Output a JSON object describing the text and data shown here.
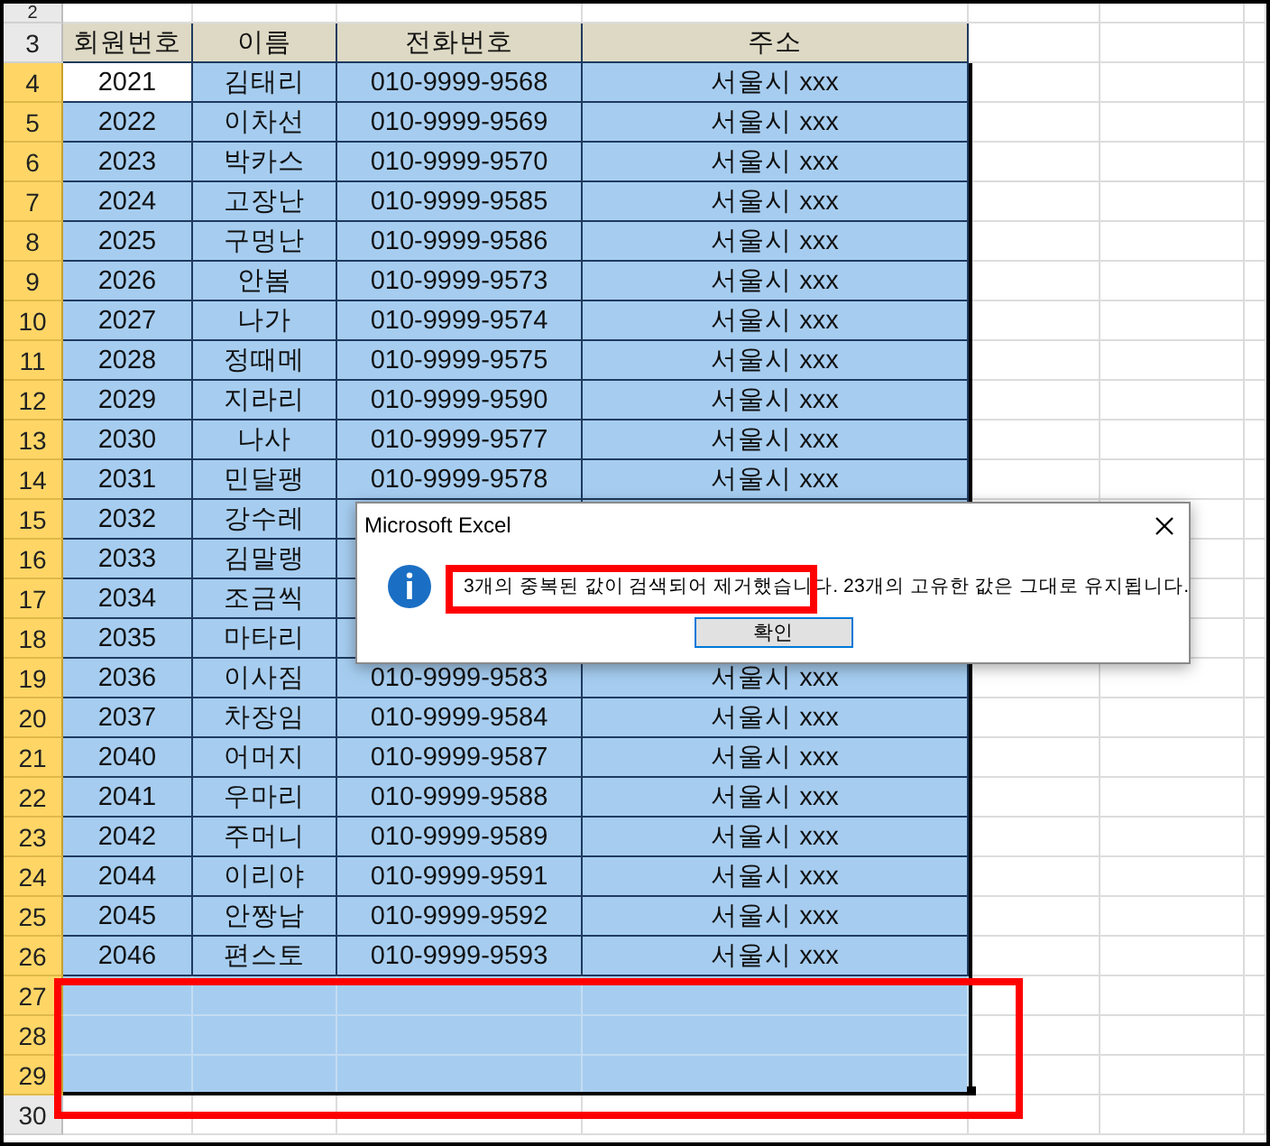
{
  "sheet": {
    "header": {
      "number": "3",
      "cells": [
        "회원번호",
        "이름",
        "전화번호",
        "주소"
      ]
    },
    "rows": [
      {
        "number": "2",
        "selected": false,
        "active": false
      },
      {
        "number": "4",
        "cells": [
          "2021",
          "김태리",
          "010-9999-9568",
          "서울시 xxx"
        ],
        "selected": true,
        "active": true
      },
      {
        "number": "5",
        "cells": [
          "2022",
          "이차선",
          "010-9999-9569",
          "서울시 xxx"
        ],
        "selected": true,
        "active": false
      },
      {
        "number": "6",
        "cells": [
          "2023",
          "박카스",
          "010-9999-9570",
          "서울시 xxx"
        ],
        "selected": true,
        "active": false
      },
      {
        "number": "7",
        "cells": [
          "2024",
          "고장난",
          "010-9999-9585",
          "서울시 xxx"
        ],
        "selected": true,
        "active": false
      },
      {
        "number": "8",
        "cells": [
          "2025",
          "구멍난",
          "010-9999-9586",
          "서울시 xxx"
        ],
        "selected": true,
        "active": false
      },
      {
        "number": "9",
        "cells": [
          "2026",
          "안봄",
          "010-9999-9573",
          "서울시 xxx"
        ],
        "selected": true,
        "active": false
      },
      {
        "number": "10",
        "cells": [
          "2027",
          "나가",
          "010-9999-9574",
          "서울시 xxx"
        ],
        "selected": true,
        "active": false
      },
      {
        "number": "11",
        "cells": [
          "2028",
          "정때메",
          "010-9999-9575",
          "서울시 xxx"
        ],
        "selected": true,
        "active": false
      },
      {
        "number": "12",
        "cells": [
          "2029",
          "지라리",
          "010-9999-9590",
          "서울시 xxx"
        ],
        "selected": true,
        "active": false
      },
      {
        "number": "13",
        "cells": [
          "2030",
          "나사",
          "010-9999-9577",
          "서울시 xxx"
        ],
        "selected": true,
        "active": false
      },
      {
        "number": "14",
        "cells": [
          "2031",
          "민달팽",
          "010-9999-9578",
          "서울시 xxx"
        ],
        "selected": true,
        "active": false
      },
      {
        "number": "15",
        "cells": [
          "2032",
          "강수레"
        ],
        "selected": true,
        "active": false
      },
      {
        "number": "16",
        "cells": [
          "2033",
          "김말랭"
        ],
        "selected": true,
        "active": false
      },
      {
        "number": "17",
        "cells": [
          "2034",
          "조금씩"
        ],
        "selected": true,
        "active": false
      },
      {
        "number": "18",
        "cells": [
          "2035",
          "마타리"
        ],
        "selected": true,
        "active": false
      },
      {
        "number": "19",
        "cells": [
          "2036",
          "이사짐",
          "010-9999-9583",
          "서울시 xxx"
        ],
        "selected": true,
        "active": false
      },
      {
        "number": "20",
        "cells": [
          "2037",
          "차장임",
          "010-9999-9584",
          "서울시 xxx"
        ],
        "selected": true,
        "active": false
      },
      {
        "number": "21",
        "cells": [
          "2040",
          "어머지",
          "010-9999-9587",
          "서울시 xxx"
        ],
        "selected": true,
        "active": false
      },
      {
        "number": "22",
        "cells": [
          "2041",
          "우마리",
          "010-9999-9588",
          "서울시 xxx"
        ],
        "selected": true,
        "active": false
      },
      {
        "number": "23",
        "cells": [
          "2042",
          "주머니",
          "010-9999-9589",
          "서울시 xxx"
        ],
        "selected": true,
        "active": false
      },
      {
        "number": "24",
        "cells": [
          "2044",
          "이리야",
          "010-9999-9591",
          "서울시 xxx"
        ],
        "selected": true,
        "active": false
      },
      {
        "number": "25",
        "cells": [
          "2045",
          "안짱남",
          "010-9999-9592",
          "서울시 xxx"
        ],
        "selected": true,
        "active": false
      },
      {
        "number": "26",
        "cells": [
          "2046",
          "편스토",
          "010-9999-9593",
          "서울시 xxx"
        ],
        "selected": true,
        "active": false
      },
      {
        "number": "27",
        "selected": true,
        "active": false
      },
      {
        "number": "28",
        "selected": true,
        "active": false
      },
      {
        "number": "29",
        "selected": true,
        "active": false
      },
      {
        "number": "30",
        "selected": false,
        "active": false
      }
    ]
  },
  "dialog": {
    "title": "Microsoft Excel",
    "message": "3개의 중복된 값이 검색되어 제거했습니다. 23개의 고유한 값은 그대로 유지됩니다.",
    "button": "확인"
  }
}
